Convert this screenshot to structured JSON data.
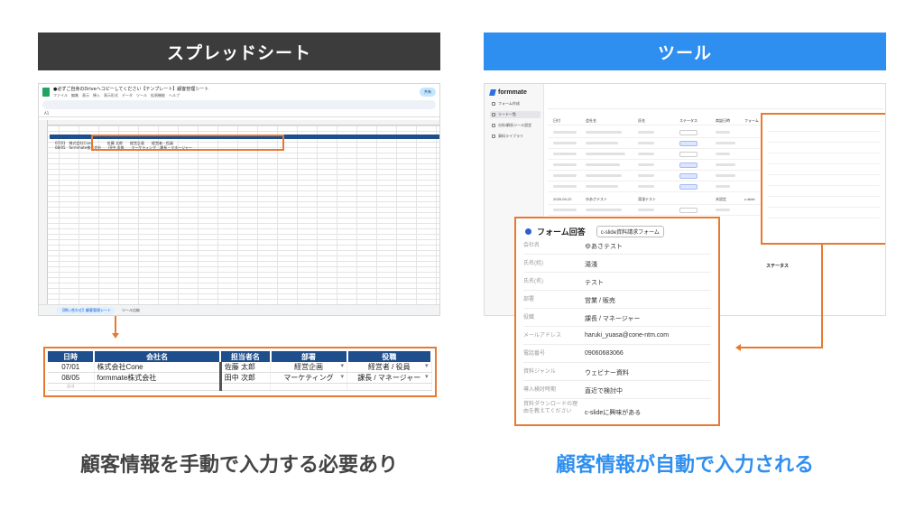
{
  "headers": {
    "left": "スプレッドシート",
    "right": "ツール"
  },
  "spreadsheet": {
    "title": "●必ずご自身のDriveへコピーしてください【テンプレート】顧客管理シート",
    "menu": "ファイル　編集　表示　挿入　表示形式　データ　ツール　拡張機能　ヘルプ",
    "share_label": "共有",
    "cell_ref": "A1",
    "active_tab": "【問い合わせ】顧客管理シート",
    "other_tab": "ツール比較",
    "rows": [
      "07/01　株式会社Cone　　　　佐藤 太郎　　経営企画　　経営者・役員",
      "08/05　formmate株式会社　　田中 次郎　　マーケティング　課長・マネージャー"
    ]
  },
  "zoom_table": {
    "headers": [
      "日時",
      "会社名",
      "担当者名",
      "部署",
      "役職"
    ],
    "rows": [
      [
        "07/01",
        "株式会社Cone",
        "佐藤 太郎",
        "経営企画",
        "経営者 / 役員"
      ],
      [
        "08/05",
        "formmate株式会社",
        "田中 次郎",
        "マーケティング",
        "課長 / マネージャー"
      ]
    ],
    "faint_row": "8/4"
  },
  "formmate": {
    "brand": "formmate",
    "nav": [
      "フォーム作成",
      "リード一覧",
      "分析/解析ツール設定",
      "資料ライブラリ"
    ],
    "columns": [
      "日付",
      "会社名",
      "氏名",
      "ステータス",
      "商談日時",
      "フォーム"
    ],
    "row_date": "2025-09-22",
    "row_company": "ゆあさテスト",
    "row_name": "湯淺テスト",
    "row_status": "未設定",
    "row_form": "c-slide",
    "status_title": "ステータス"
  },
  "form_panel": {
    "title": "フォーム回答",
    "chip": "c-slide資料請求フォーム",
    "fields": [
      {
        "label": "会社名",
        "value": "ゆあさテスト"
      },
      {
        "label": "氏名(姓)",
        "value": "湯淺"
      },
      {
        "label": "氏名(名)",
        "value": "テスト"
      },
      {
        "label": "部署",
        "value": "営業 / 販売"
      },
      {
        "label": "役職",
        "value": "課長 / マネージャー"
      },
      {
        "label": "メールアドレス",
        "value": "haruki_yuasa@cone-ntm.com"
      },
      {
        "label": "電話番号",
        "value": "09060683066"
      },
      {
        "label": "資料ジャンル",
        "value": "ウェビナー資料"
      },
      {
        "label": "導入検討時期",
        "value": "直近で検討中"
      },
      {
        "label": "資料ダウンロードの理由を教えてください",
        "value": "c-slideに興味がある"
      }
    ]
  },
  "captions": {
    "left": "顧客情報を手動で入力する必要あり",
    "right": "顧客情報が自動で入力される"
  },
  "colors": {
    "header_left": "#3c3c3c",
    "header_right": "#2f8ff0",
    "highlight": "#e8792f",
    "table_header": "#1f4e8c"
  }
}
